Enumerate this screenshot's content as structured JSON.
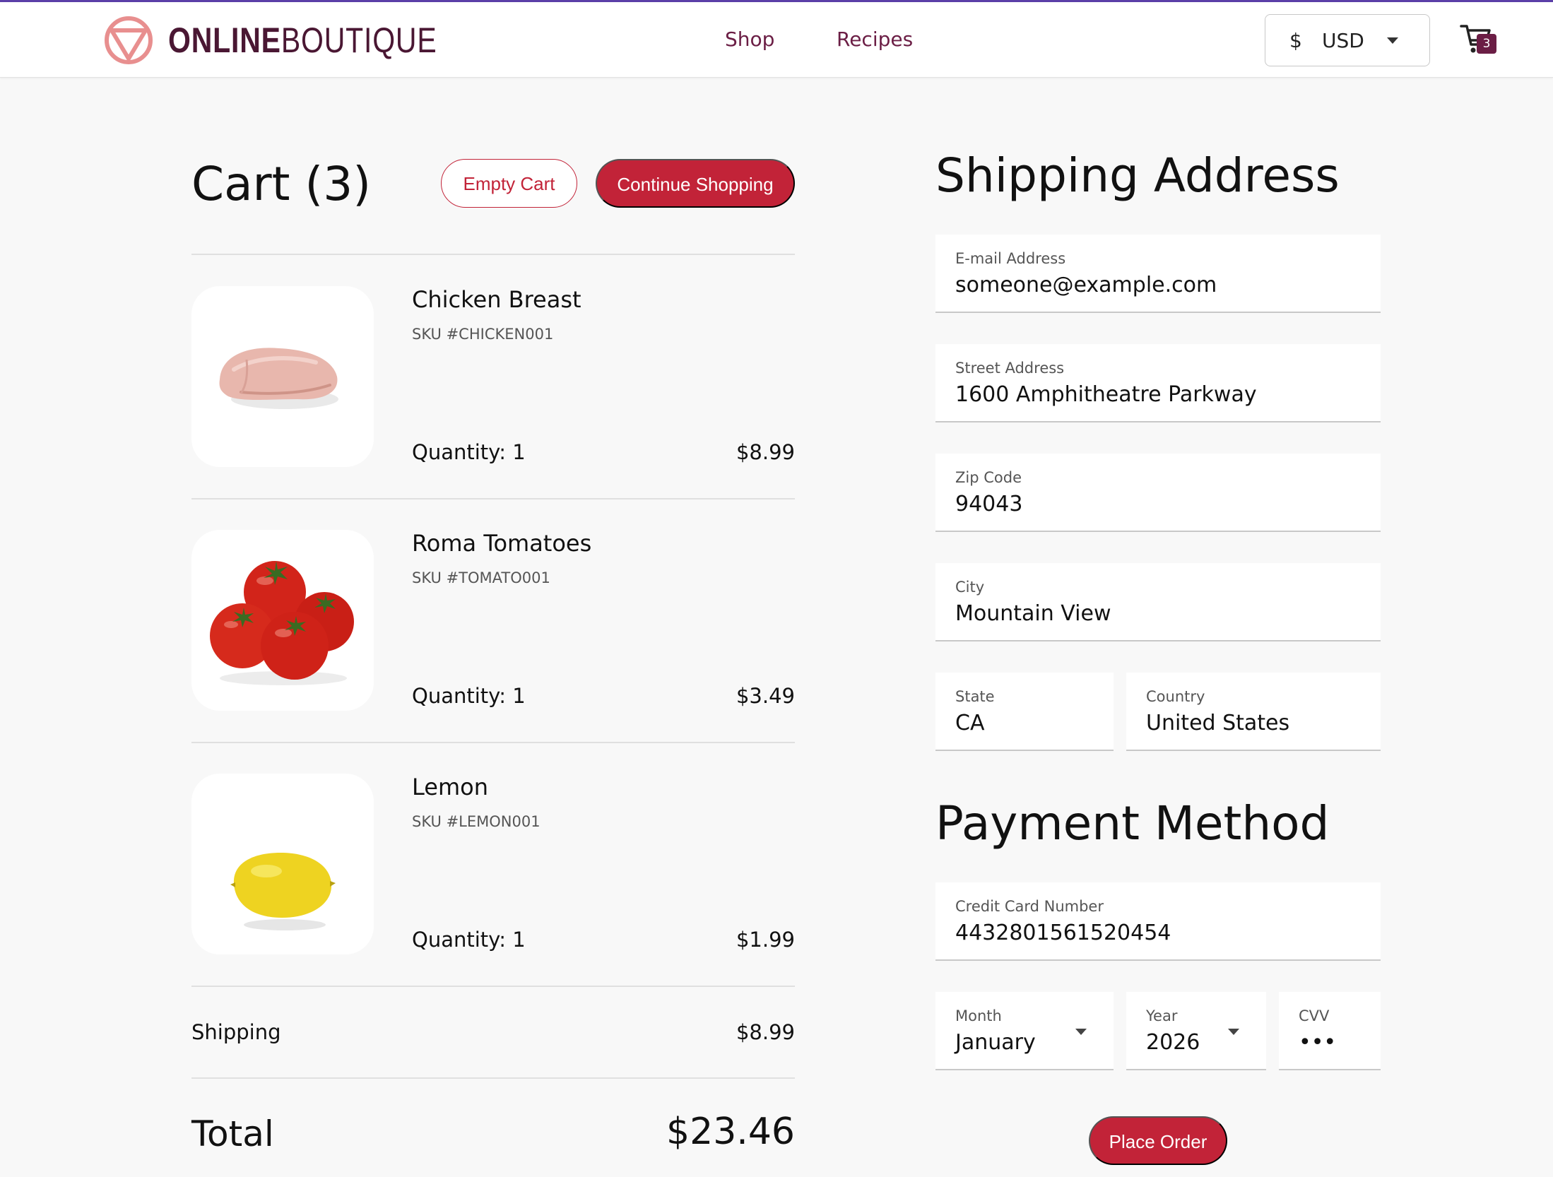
{
  "header": {
    "logo_bold": "ONLINE",
    "logo_light": "BOUTIQUE",
    "nav": [
      {
        "label": "Shop"
      },
      {
        "label": "Recipes"
      }
    ],
    "currency_symbol": "$",
    "currency_code": "USD",
    "cart_count": "3"
  },
  "cart": {
    "title": "Cart (3)",
    "empty_label": "Empty Cart",
    "continue_label": "Continue Shopping",
    "items": [
      {
        "name": "Chicken Breast",
        "sku": "SKU #CHICKEN001",
        "quantity": "Quantity: 1",
        "price": "$8.99",
        "image": "chicken-breast-image"
      },
      {
        "name": "Roma Tomatoes",
        "sku": "SKU #TOMATO001",
        "quantity": "Quantity: 1",
        "price": "$3.49",
        "image": "tomatoes-image"
      },
      {
        "name": "Lemon",
        "sku": "SKU #LEMON001",
        "quantity": "Quantity: 1",
        "price": "$1.99",
        "image": "lemon-image"
      }
    ],
    "shipping_label": "Shipping",
    "shipping_value": "$8.99",
    "total_label": "Total",
    "total_value": "$23.46"
  },
  "shipping": {
    "title": "Shipping Address",
    "email": {
      "label": "E-mail Address",
      "value": "someone@example.com"
    },
    "street": {
      "label": "Street Address",
      "value": "1600 Amphitheatre Parkway"
    },
    "zip": {
      "label": "Zip Code",
      "value": "94043"
    },
    "city": {
      "label": "City",
      "value": "Mountain View"
    },
    "state": {
      "label": "State",
      "value": "CA"
    },
    "country": {
      "label": "Country",
      "value": "United States"
    }
  },
  "payment": {
    "title": "Payment Method",
    "card": {
      "label": "Credit Card Number",
      "value": "4432801561520454"
    },
    "month": {
      "label": "Month",
      "value": "January"
    },
    "year": {
      "label": "Year",
      "value": "2026"
    },
    "cvv": {
      "label": "CVV",
      "value": "•••"
    },
    "place_order_label": "Place Order"
  },
  "colors": {
    "accent": "#c22338",
    "brand": "#6b1e45",
    "top_line": "#5b3fa8"
  }
}
